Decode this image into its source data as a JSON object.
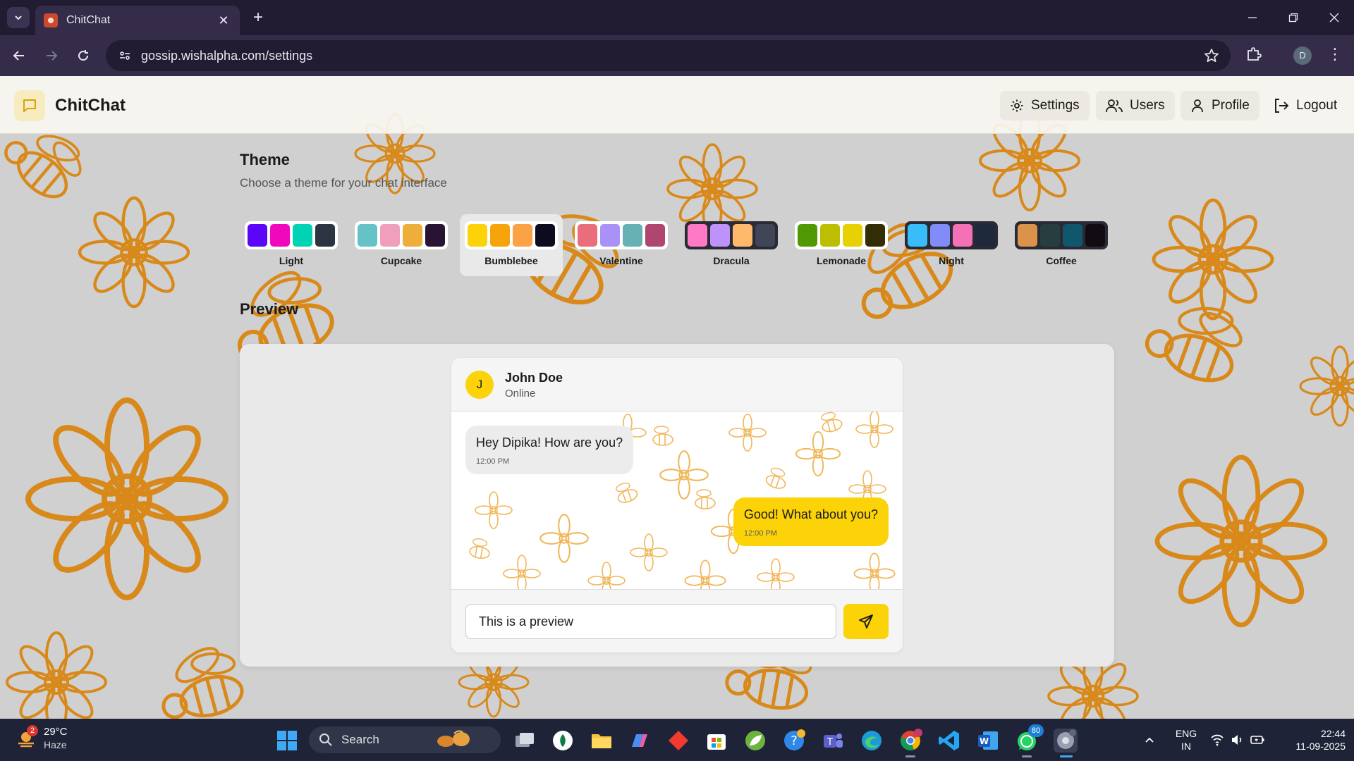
{
  "browser": {
    "tab_title": "ChitChat",
    "url": "gossip.wishalpha.com/settings",
    "profile_initial": "D"
  },
  "app": {
    "brand": "ChitChat",
    "nav": {
      "settings": "Settings",
      "users": "Users",
      "profile": "Profile",
      "logout": "Logout"
    }
  },
  "theme_section": {
    "title": "Theme",
    "subtitle": "Choose a theme for your chat interface",
    "themes": [
      {
        "name": "Light",
        "colors": [
          "#5b06f6",
          "#f108bd",
          "#00d3b5",
          "#2b3440"
        ],
        "active": false
      },
      {
        "name": "Cupcake",
        "colors": [
          "#65c3c8",
          "#ef9fbc",
          "#eeaf3a",
          "#291334"
        ],
        "active": false
      },
      {
        "name": "Bumblebee",
        "colors": [
          "#fcd308",
          "#f6a40b",
          "#fba247",
          "#0d0b1e"
        ],
        "active": true
      },
      {
        "name": "Valentine",
        "colors": [
          "#e96d7b",
          "#a991f7",
          "#66b1b3",
          "#af4670"
        ],
        "active": false
      },
      {
        "name": "Dracula",
        "colors": [
          "#ff79c6",
          "#bd93f9",
          "#ffb86c",
          "#414558"
        ],
        "active": false
      },
      {
        "name": "Lemonade",
        "colors": [
          "#519903",
          "#bcbe00",
          "#e7d004",
          "#332d06"
        ],
        "active": false
      },
      {
        "name": "Night",
        "colors": [
          "#38bdf8",
          "#818cf8",
          "#f471b5",
          "#1e293b"
        ],
        "active": false
      },
      {
        "name": "Coffee",
        "colors": [
          "#db924b",
          "#263e3f",
          "#10576d",
          "#120c12"
        ],
        "active": false
      }
    ]
  },
  "preview": {
    "title": "Preview",
    "contact_initial": "J",
    "contact_name": "John Doe",
    "contact_status": "Online",
    "messages": [
      {
        "text": "Hey Dipika! How are you?",
        "time": "12:00 PM",
        "sent": false
      },
      {
        "text": "Good! What about you?",
        "time": "12:00 PM",
        "sent": true
      }
    ],
    "input_value": "This is a preview"
  },
  "taskbar": {
    "weather_badge": "2",
    "temperature": "29°C",
    "weather": "Haze",
    "search_placeholder": "Search",
    "whatsapp_badge": "80",
    "lang_line1": "ENG",
    "lang_line2": "IN",
    "time": "22:44",
    "date": "11-09-2025"
  },
  "colors": {
    "accent": "#fcd308",
    "pattern": "#d8891a",
    "chrome_dark": "#221c33",
    "chrome_mid": "#342c48"
  }
}
